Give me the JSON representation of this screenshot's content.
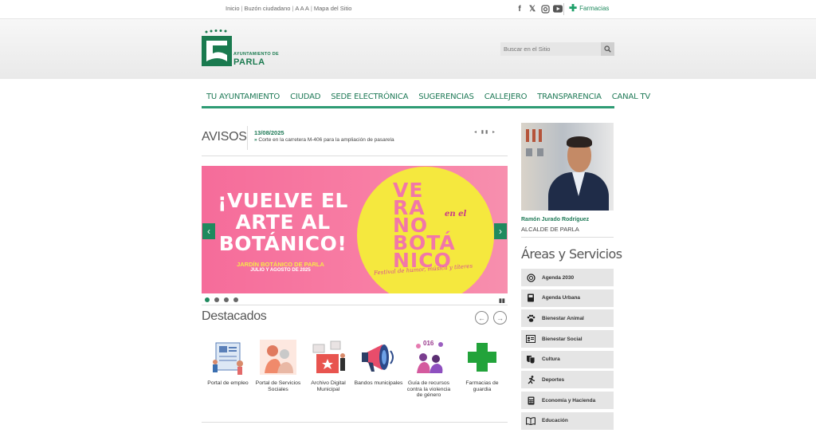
{
  "topbar": {
    "links": [
      "Inicio",
      "Buzón ciudadano",
      "A A A",
      "Mapa del Sitio"
    ],
    "pharmacy": "Farmacias"
  },
  "header": {
    "logo_line1": "AYUNTAMIENTO DE",
    "logo_line2": "PARLA",
    "search_placeholder": "Buscar en el Sitio"
  },
  "nav": [
    "TU AYUNTAMIENTO",
    "CIUDAD",
    "SEDE ELECTRÓNICA",
    "SUGERENCIAS",
    "CALLEJERO",
    "TRANSPARENCIA",
    "CANAL TV"
  ],
  "avisos": {
    "title": "AVISOS",
    "date": "13/08/2025",
    "text": "Corte en la carretera M-406 para la ampliación de pasarela",
    "controls": "◂ ▮▮ ▸"
  },
  "banner": {
    "headline": "¡VUELVE EL ARTE AL BOTÁNICO!",
    "place": "JARDÍN BOTÁNICO DE PARLA",
    "dates": "JULIO Y AGOSTO DE 2025",
    "vertical_text": "VE RA NO BOTÁ NICO",
    "en_el": "en el",
    "festival": "Festival de humor, música y títeres"
  },
  "destacados": {
    "title": "Destacados",
    "items": [
      {
        "label": "Portal de empleo"
      },
      {
        "label": "Portal de Servicios Sociales"
      },
      {
        "label": "Archivo Digital Municipal"
      },
      {
        "label": "Bandos municipales"
      },
      {
        "label": "Guía de recursos contra la violencia de género",
        "badge": "016"
      },
      {
        "label": "Farmacias de guardia"
      }
    ]
  },
  "alcalde": {
    "name": "Ramón Jurado Rodríguez",
    "role": "ALCALDE DE PARLA"
  },
  "areas": {
    "title": "Áreas y Servicios",
    "items": [
      {
        "label": "Agenda 2030",
        "icon": "globe-icon"
      },
      {
        "label": "Agenda Urbana",
        "icon": "book-icon"
      },
      {
        "label": "Bienestar Animal",
        "icon": "paw-icon"
      },
      {
        "label": "Bienestar Social",
        "icon": "id-card-icon"
      },
      {
        "label": "Cultura",
        "icon": "masks-icon"
      },
      {
        "label": "Deportes",
        "icon": "running-icon"
      },
      {
        "label": "Economía y Hacienda",
        "icon": "calculator-icon"
      },
      {
        "label": "Educación",
        "icon": "open-book-icon"
      }
    ]
  },
  "colors": {
    "brand_green": "#1f8a5e",
    "banner_pink": "#f56c9a",
    "banner_yellow": "#f5e83e"
  }
}
